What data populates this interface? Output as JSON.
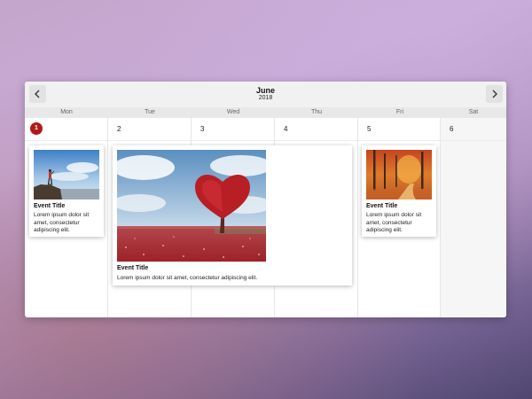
{
  "header": {
    "month": "June",
    "year": "2018"
  },
  "weekdays": [
    "Mon",
    "Tue",
    "Wed",
    "Thu",
    "Fri",
    "Sat"
  ],
  "dates": [
    "1",
    "2",
    "3",
    "4",
    "5",
    "6"
  ],
  "events": [
    {
      "title": "Event Title",
      "description": "Lorem ipsum dolor sit amet, consectetur adipiscing elit.",
      "image": "hiker-on-cliff"
    },
    {
      "title": "Event Title",
      "description": "Lorem ipsum dolor sit amet, consectetur adipiscing elit.",
      "image": "heart-tree-field"
    },
    {
      "title": "Event Title",
      "description": "Lorem ipsum dolor sit amet, consectetur adipiscing elit.",
      "image": "autumn-forest-path"
    }
  ],
  "colors": {
    "accent": "#b01a1a"
  }
}
